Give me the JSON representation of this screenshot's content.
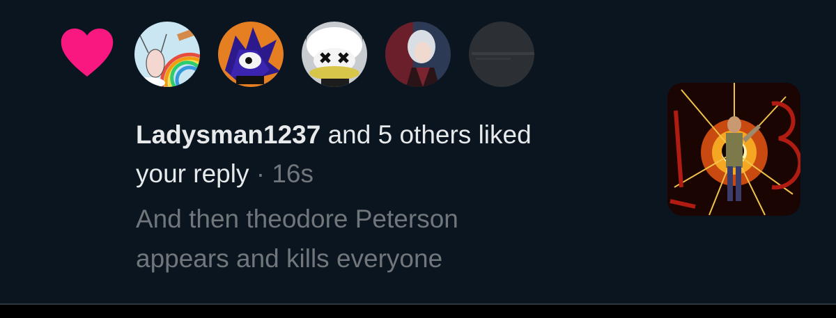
{
  "notification": {
    "icon": "heart-icon",
    "heart_color": "#f91880",
    "avatars": [
      {
        "name": "avatar-rainbow-drawing",
        "icon": "rainbow-cartoon-avatar"
      },
      {
        "name": "avatar-blue-hedgehog",
        "icon": "blue-hedgehog-avatar"
      },
      {
        "name": "avatar-masked-face",
        "icon": "masked-face-avatar"
      },
      {
        "name": "avatar-anime-character",
        "icon": "anime-character-avatar"
      },
      {
        "name": "avatar-placeholder",
        "icon": "blank-avatar"
      }
    ],
    "username": "Ladysman1237",
    "action_line": " and 5 others liked",
    "action_line2": "your reply",
    "separator": " · ",
    "timestamp": "16s",
    "reply_snippet_line1": "And then theodore Peterson",
    "reply_snippet_line2": "appears and kills everyone",
    "thumbnail": "game-artwork-thumbnail"
  },
  "colors": {
    "background": "#0a1520",
    "text_primary": "#e7e9ea",
    "text_secondary": "#71767b",
    "like": "#f91880"
  }
}
